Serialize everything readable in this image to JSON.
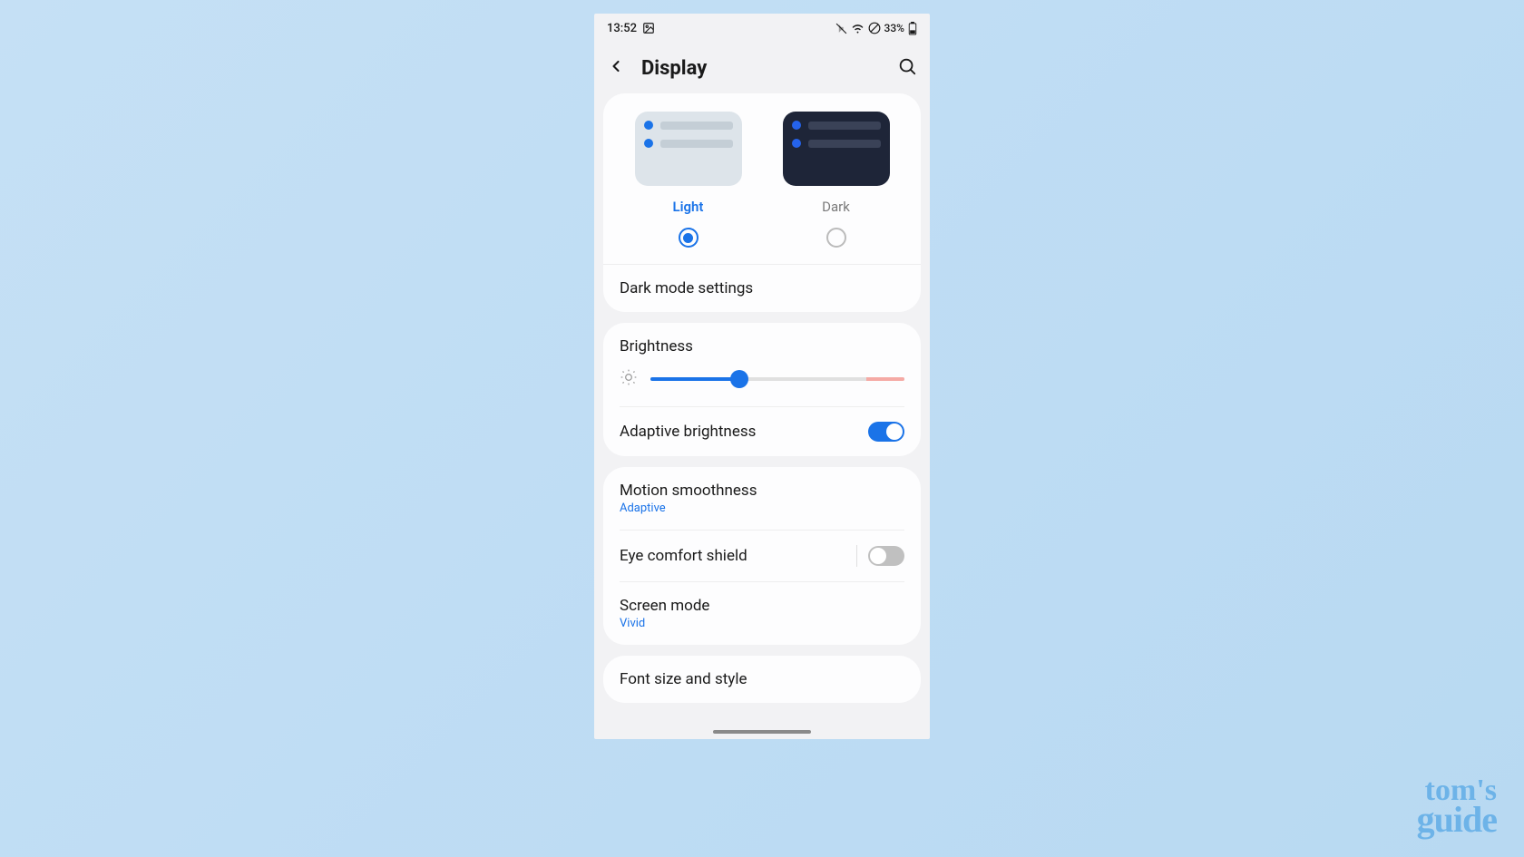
{
  "status": {
    "time": "13:52",
    "battery_percent": "33%",
    "icons": [
      "screenshot",
      "mute",
      "wifi",
      "no-data",
      "battery"
    ]
  },
  "header": {
    "title": "Display"
  },
  "theme": {
    "light_label": "Light",
    "dark_label": "Dark",
    "selected": "light"
  },
  "dark_mode_settings_label": "Dark mode settings",
  "brightness": {
    "label": "Brightness",
    "value_percent": 35
  },
  "adaptive_brightness": {
    "label": "Adaptive brightness",
    "enabled": true
  },
  "motion_smoothness": {
    "label": "Motion smoothness",
    "value": "Adaptive"
  },
  "eye_comfort": {
    "label": "Eye comfort shield",
    "enabled": false
  },
  "screen_mode": {
    "label": "Screen mode",
    "value": "Vivid"
  },
  "font_size": {
    "label": "Font size and style"
  },
  "watermark": {
    "line1": "tom's",
    "line2": "guide"
  }
}
